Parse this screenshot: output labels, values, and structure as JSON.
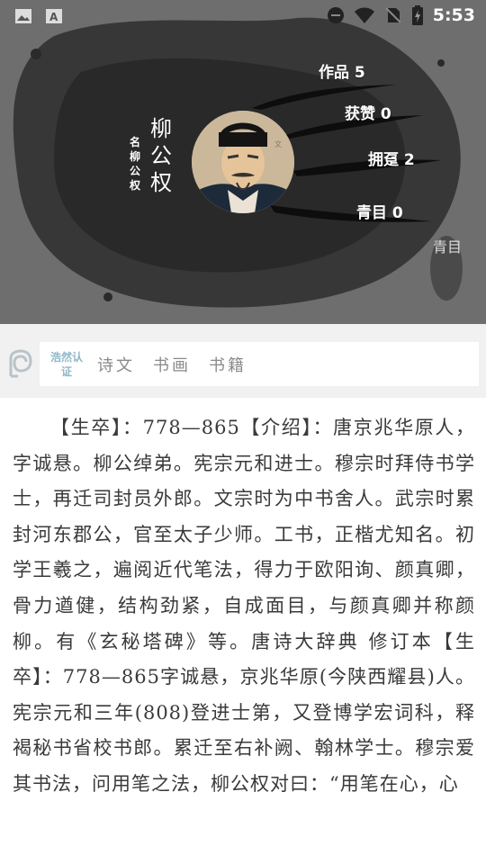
{
  "status_bar": {
    "time": "5:53"
  },
  "profile": {
    "name": "柳公权",
    "name_label": "名 柳公权",
    "seal": "青目",
    "stats": [
      {
        "label": "作品",
        "value": "5"
      },
      {
        "label": "获赞",
        "value": "0"
      },
      {
        "label": "拥趸",
        "value": "2"
      },
      {
        "label": "青目",
        "value": "0"
      }
    ]
  },
  "tabs": {
    "verified": "浩然认证",
    "items": [
      "诗文",
      "书画",
      "书籍"
    ]
  },
  "bio": "【生卒】：778—865【介绍】：唐京兆华原人，字诚悬。柳公绰弟。宪宗元和进士。穆宗时拜侍书学士，再迁司封员外郎。文宗时为中书舍人。武宗时累封河东郡公，官至太子少师。工书，正楷尤知名。初学王羲之，遍阅近代笔法，得力于欧阳询、颜真卿，骨力遒健，结构劲紧，自成面目，与颜真卿并称颜柳。有《玄秘塔碑》等。唐诗大辞典 修订本【生卒】：778—865字诚悬，京兆华原(今陕西耀县)人。宪宗元和三年(808)登进士第，又登博学宏词科，释褐秘书省校书郎。累迁至右补阙、翰林学士。穆宗爱其书法，问用笔之法，柳公权对曰：“用笔在心，心"
}
